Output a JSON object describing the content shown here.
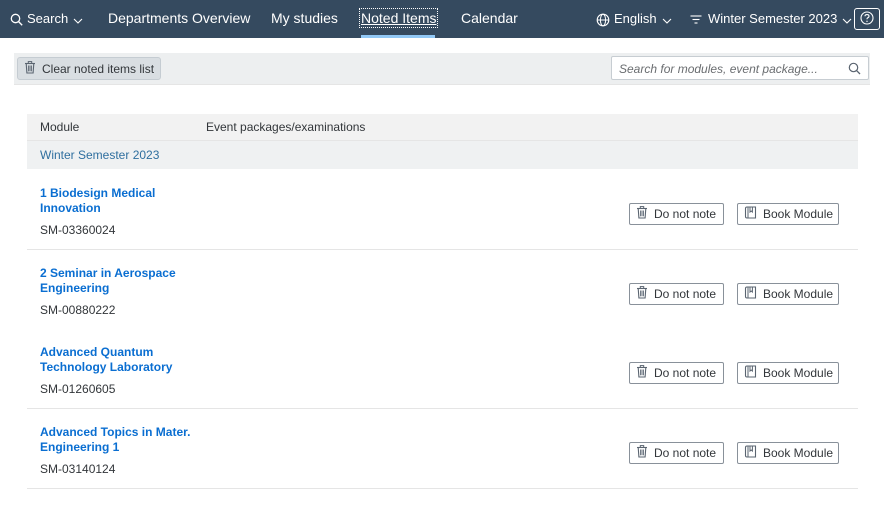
{
  "nav": {
    "search_label": "Search",
    "departments": "Departments Overview",
    "my_studies": "My studies",
    "noted_items": "Noted Items",
    "calendar": "Calendar",
    "language": "English",
    "semester": "Winter Semester 2023"
  },
  "toolbar": {
    "clear_label": "Clear noted items list",
    "search_placeholder": "Search for modules, event package..."
  },
  "table": {
    "headers": [
      "Module",
      "Event packages/examinations"
    ],
    "group_label": "Winter Semester 2023",
    "do_not_note_label": "Do not note",
    "book_module_label": "Book Module",
    "rows": [
      {
        "title": "1 Biodesign Medical Innovation",
        "code": "SM-03360024"
      },
      {
        "title": "2 Seminar in Aerospace Engineering",
        "code": "SM-00880222"
      },
      {
        "title": "Advanced Quantum Technology Laboratory",
        "code": "SM-01260605"
      },
      {
        "title": "Advanced Topics in Mater. Engineering 1",
        "code": "SM-03140124"
      }
    ]
  },
  "colors": {
    "header_bg": "#354a5f",
    "link": "#0a6ed1",
    "group_text": "#2f6f9f"
  },
  "icons": [
    "search-icon",
    "chevron-down-icon",
    "globe-icon",
    "filter-icon",
    "help-icon",
    "trash-icon",
    "book-icon"
  ]
}
